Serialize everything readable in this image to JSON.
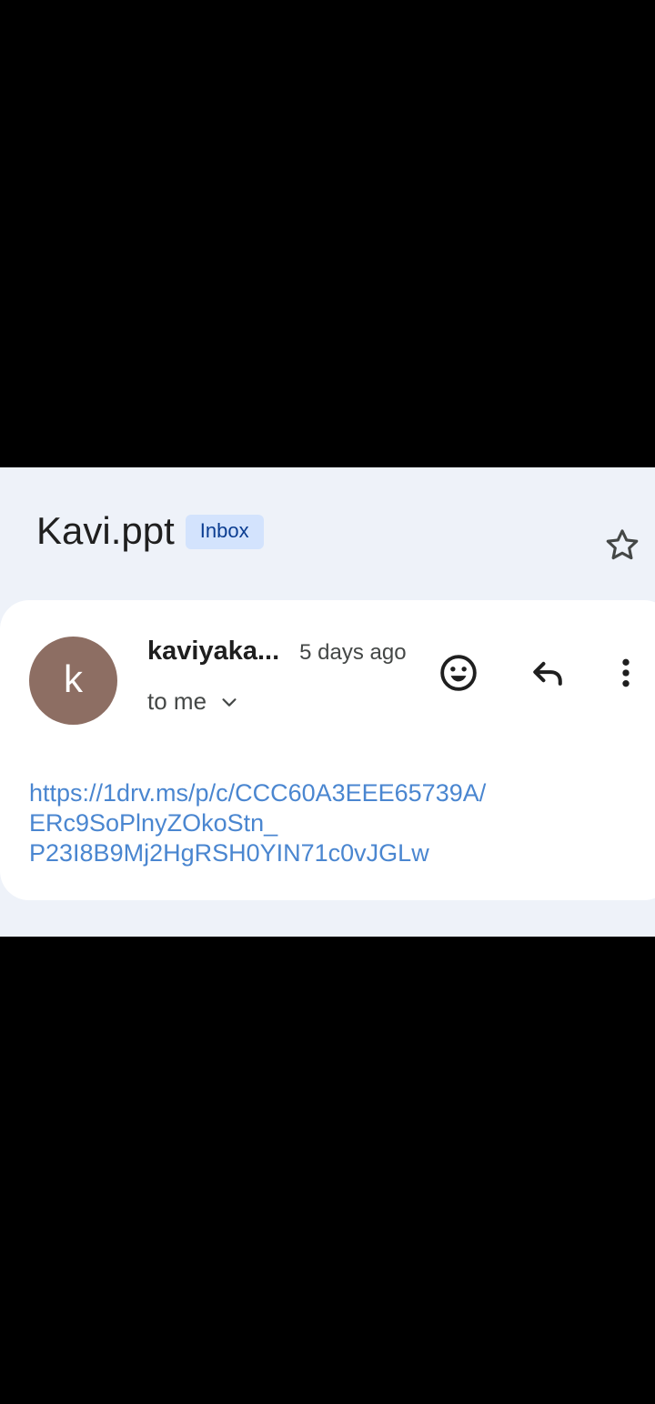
{
  "email": {
    "subject": "Kavi.ppt",
    "label": "Inbox",
    "sender_initial": "k",
    "sender_name": "kaviyaka...",
    "time": "5 days ago",
    "recipient": "to me",
    "link_lines": [
      "https://1drv.ms/p/c/CCC60A3EEE65739A/",
      "ERc9SoPlnyZOkoStn_",
      "P23I8B9Mj2HgRSH0YIN71c0vJGLw"
    ]
  },
  "icons": {
    "star": "star-outline-icon",
    "emoji": "add-reaction-icon",
    "reply": "reply-icon",
    "more": "more-vert-icon",
    "chevron": "chevron-down-icon"
  },
  "colors": {
    "panel_background": "#eef2f9",
    "card_background": "#ffffff",
    "avatar": "#8d6e63",
    "label_chip": "#d3e3fd",
    "link": "#4a86d0"
  }
}
